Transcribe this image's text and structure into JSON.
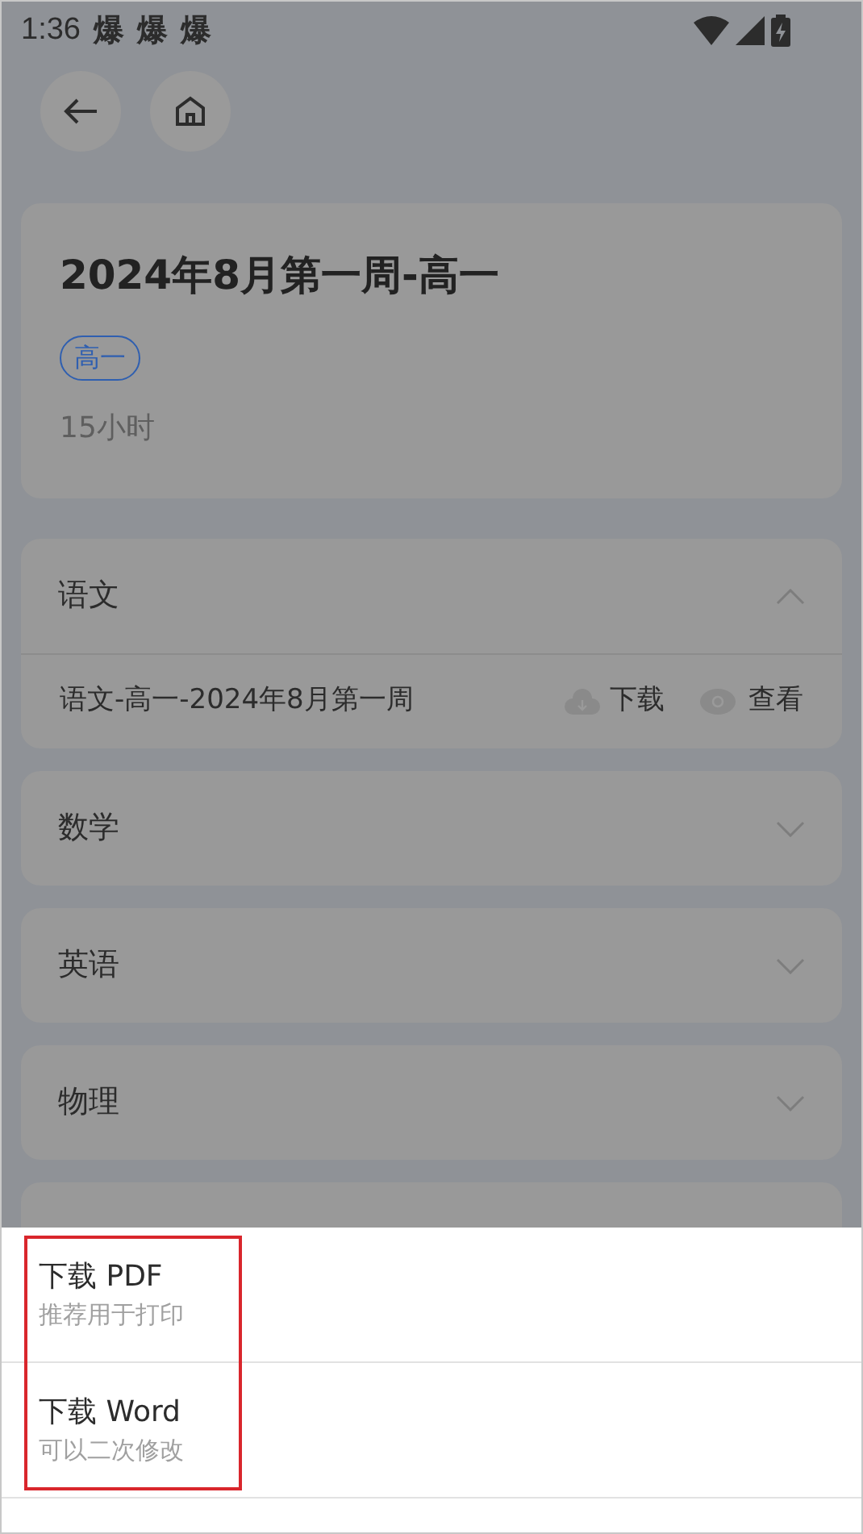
{
  "status_bar": {
    "time": "1:36",
    "notification_icons": [
      "爆",
      "爆",
      "爆"
    ]
  },
  "course": {
    "title": "2024年8月第一周-高一",
    "tag": "高一",
    "duration": "15小时"
  },
  "subjects": [
    {
      "name": "语文",
      "expanded": true,
      "files": [
        {
          "name": "语文-高一-2024年8月第一周",
          "download": "下载",
          "view": "查看"
        }
      ]
    },
    {
      "name": "数学",
      "expanded": false
    },
    {
      "name": "英语",
      "expanded": false
    },
    {
      "name": "物理",
      "expanded": false
    }
  ],
  "sheet": {
    "highlighted": true,
    "options": [
      {
        "title": "下载 PDF",
        "subtitle": "推荐用于打印"
      },
      {
        "title": "下载 Word",
        "subtitle": "可以二次修改"
      }
    ]
  }
}
